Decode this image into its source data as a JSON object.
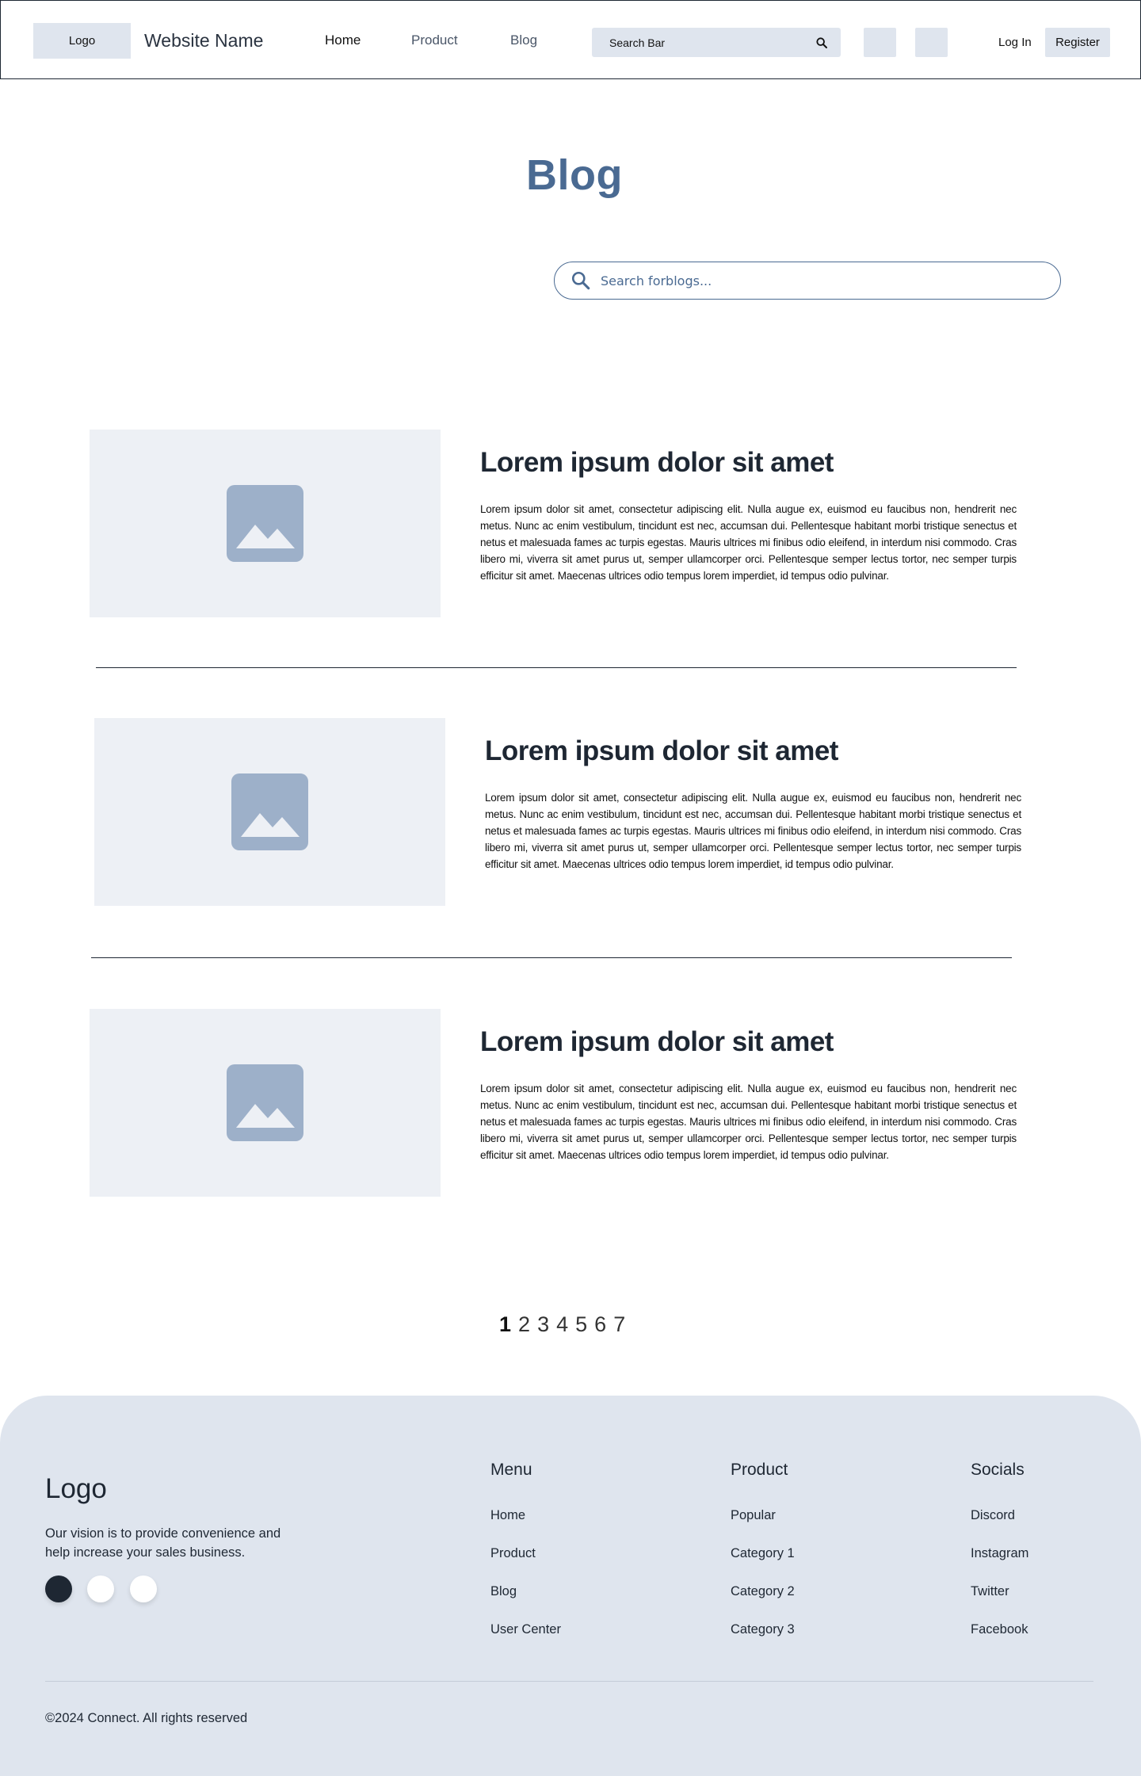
{
  "header": {
    "logo": "Logo",
    "site_name": "Website Name",
    "nav": [
      "Home",
      "Product",
      "Blog"
    ],
    "active_nav": "Home",
    "search_label": "Search Bar",
    "login": "Log In",
    "register": "Register"
  },
  "page": {
    "title": "Blog",
    "search_placeholder": "Search forblogs..."
  },
  "articles": [
    {
      "title": "Lorem ipsum dolor sit amet",
      "body": "Lorem ipsum dolor sit amet, consectetur adipiscing elit. Nulla augue ex, euismod eu faucibus non, hendrerit nec metus. Nunc ac enim vestibulum, tincidunt est nec, accumsan dui. Pellentesque habitant morbi tristique senectus et netus et malesuada fames ac turpis egestas. Mauris ultrices mi finibus odio eleifend, in interdum nisi commodo. Cras libero mi, viverra sit amet purus ut, semper ullamcorper orci. Pellentesque semper lectus tortor, nec semper turpis efficitur sit amet. Maecenas ultrices odio tempus lorem imperdiet, id tempus odio pulvinar."
    },
    {
      "title": "Lorem ipsum dolor sit amet",
      "body": "Lorem ipsum dolor sit amet, consectetur adipiscing elit. Nulla augue ex, euismod eu faucibus non, hendrerit nec metus. Nunc ac enim vestibulum, tincidunt est nec, accumsan dui. Pellentesque habitant morbi tristique senectus et netus et malesuada fames ac turpis egestas. Mauris ultrices mi finibus odio eleifend, in interdum nisi commodo. Cras libero mi, viverra sit amet purus ut, semper ullamcorper orci. Pellentesque semper lectus tortor, nec semper turpis efficitur sit amet. Maecenas ultrices odio tempus lorem imperdiet, id tempus odio pulvinar."
    },
    {
      "title": "Lorem ipsum dolor sit amet",
      "body": "Lorem ipsum dolor sit amet, consectetur adipiscing elit. Nulla augue ex, euismod eu faucibus non, hendrerit nec metus. Nunc ac enim vestibulum, tincidunt est nec, accumsan dui. Pellentesque habitant morbi tristique senectus et netus et malesuada fames ac turpis egestas. Mauris ultrices mi finibus odio eleifend, in interdum nisi commodo. Cras libero mi, viverra sit amet purus ut, semper ullamcorper orci. Pellentesque semper lectus tortor, nec semper turpis efficitur sit amet. Maecenas ultrices odio tempus lorem imperdiet, id tempus odio pulvinar."
    }
  ],
  "pagination": {
    "pages": [
      "1",
      "2",
      "3",
      "4",
      "5",
      "6",
      "7"
    ],
    "current": "1"
  },
  "footer": {
    "logo": "Logo",
    "vision": "Our vision is to provide convenience and help increase your sales business.",
    "columns": [
      {
        "title": "Menu",
        "links": [
          "Home",
          "Product",
          "Blog",
          "User Center"
        ]
      },
      {
        "title": "Product",
        "links": [
          "Popular",
          "Category 1",
          "Category 2",
          "Category 3"
        ]
      },
      {
        "title": "Socials",
        "links": [
          "Discord",
          "Instagram",
          "Twitter",
          "Facebook"
        ]
      }
    ],
    "copyright": "©2024 Connect. All rights reserved"
  },
  "icons": {
    "top_search": "search-icon",
    "blog_search": "search-icon",
    "thumbnail": "image-placeholder-icon"
  },
  "colors": {
    "accent": "#4a6a92",
    "panel": "#dfe5ee",
    "thumb_bg": "#edf0f5",
    "thumb_icon": "#9db0c9",
    "text_dark": "#1e2733"
  }
}
